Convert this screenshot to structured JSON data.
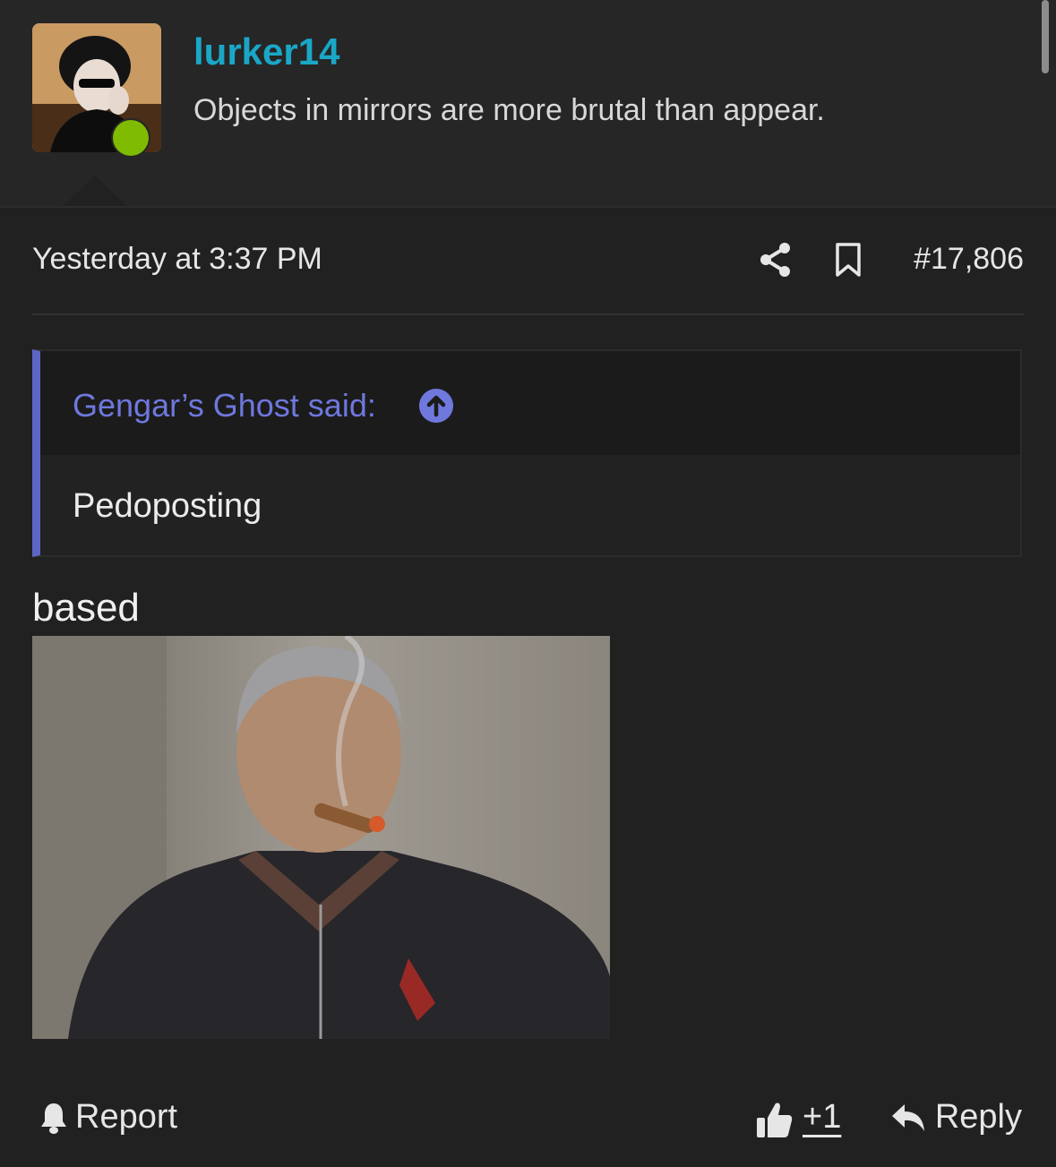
{
  "user": {
    "name": "lurker14",
    "title": "Objects in mirrors are more brutal than appear.",
    "status": "online"
  },
  "post": {
    "timestamp": "Yesterday at 3:37 PM",
    "number": "#17,806",
    "text": "based",
    "image_alt": "Photo of a man in a dark zip-up sweater smoking a cigar"
  },
  "quote": {
    "author": "Gengar’s Ghost said:",
    "text": "Pedoposting"
  },
  "actions": {
    "report": "Report",
    "like_count": "+1",
    "reply": "Reply"
  },
  "colors": {
    "background": "#212121",
    "username": "#1aa7c7",
    "quote_accent": "#5d66c4",
    "online": "#7fbb00"
  },
  "icons": [
    "share-icon",
    "bookmark-icon",
    "arrow-up-circle-icon",
    "bell-icon",
    "thumbs-up-icon",
    "reply-arrow-icon"
  ]
}
